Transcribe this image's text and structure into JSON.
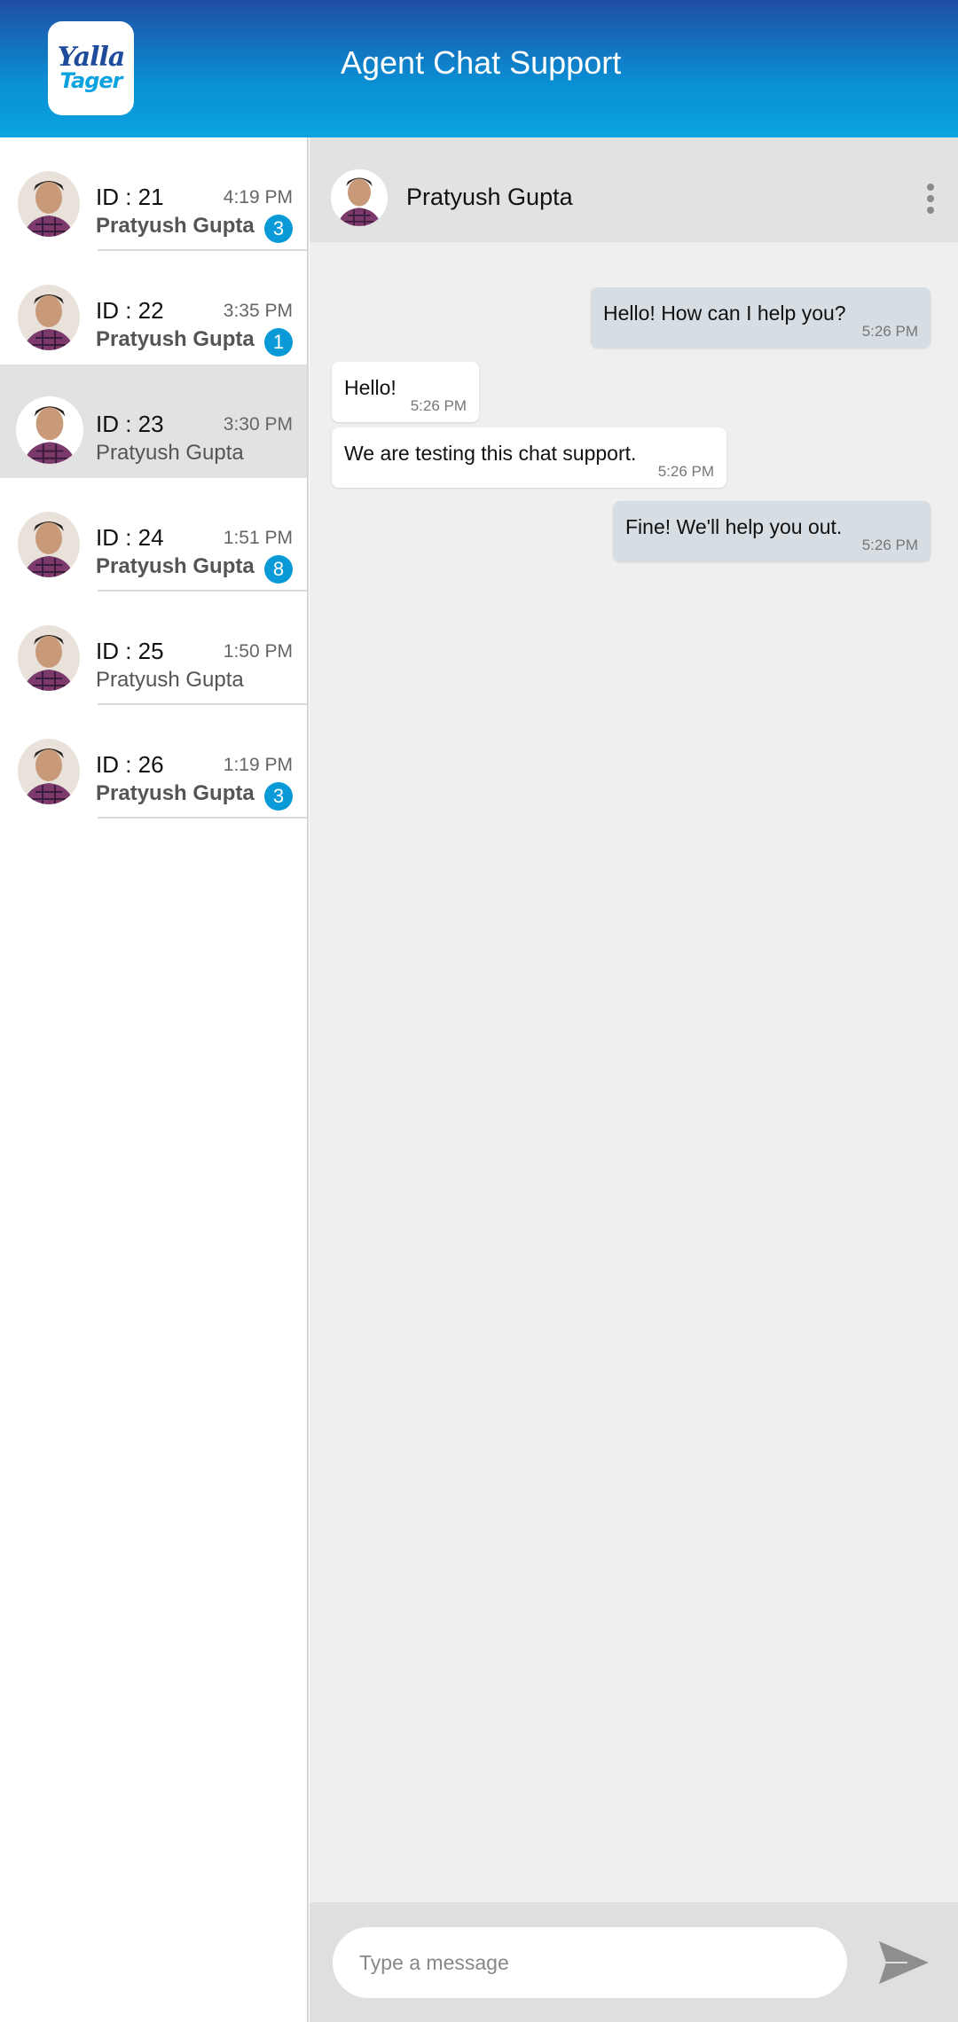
{
  "header": {
    "logo_line1": "Yalla",
    "logo_line2": "Tager",
    "title": "Agent Chat Support"
  },
  "conversations": [
    {
      "id": "ID : 21",
      "time": "4:19 PM",
      "name": "Pratyush Gupta",
      "unread": "3"
    },
    {
      "id": "ID : 22",
      "time": "3:35 PM",
      "name": "Pratyush Gupta",
      "unread": "1"
    },
    {
      "id": "ID : 23",
      "time": "3:30 PM",
      "name": "Pratyush Gupta",
      "unread": ""
    },
    {
      "id": "ID : 24",
      "time": "1:51 PM",
      "name": "Pratyush Gupta",
      "unread": "8"
    },
    {
      "id": "ID : 25",
      "time": "1:50 PM",
      "name": "Pratyush Gupta",
      "unread": ""
    },
    {
      "id": "ID : 26",
      "time": "1:19 PM",
      "name": "Pratyush Gupta",
      "unread": "3"
    }
  ],
  "chat": {
    "contact_name": "Pratyush Gupta",
    "messages": [
      {
        "direction": "out",
        "text": "Hello! How can I help you?",
        "time": "5:26 PM"
      },
      {
        "direction": "in",
        "text": "Hello!",
        "time": "5:26 PM"
      },
      {
        "direction": "in",
        "text": "We are testing this chat support.",
        "time": "5:26 PM"
      },
      {
        "direction": "out",
        "text": "Fine! We'll help you out.",
        "time": "5:26 PM"
      }
    ]
  },
  "composer": {
    "placeholder": "Type a message"
  },
  "icons": {
    "more": "more-vertical-icon",
    "send": "send-icon"
  },
  "colors": {
    "header_top": "#1f4ea3",
    "header_bottom": "#0aa3e0",
    "badge": "#0a9ad8",
    "outgoing_bubble": "#d6dde3",
    "incoming_bubble": "#ffffff",
    "active_row": "#e2e2e2"
  }
}
